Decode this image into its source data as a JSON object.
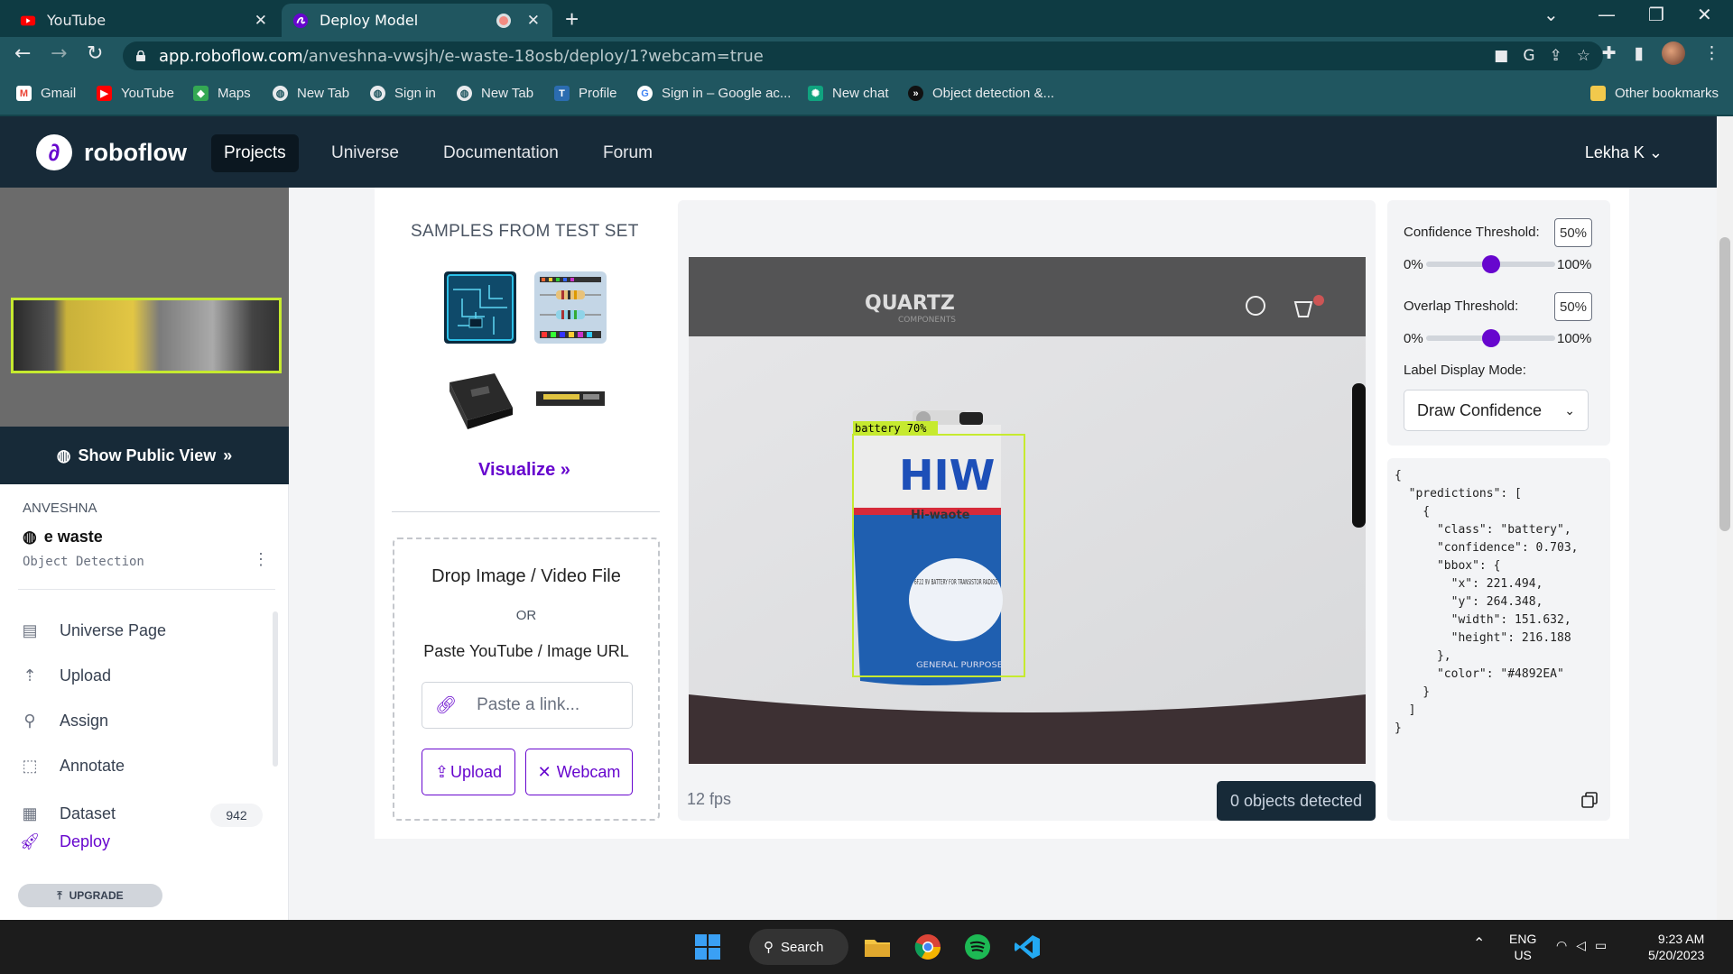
{
  "browser": {
    "tabs": [
      {
        "title": "YouTube"
      },
      {
        "title": "Deploy Model"
      }
    ],
    "url_domain": "app.roboflow.com",
    "url_path": "/anveshna-vwsjh/e-waste-18osb/deploy/1?webcam=true",
    "bookmarks": [
      "Gmail",
      "YouTube",
      "Maps",
      "New Tab",
      "Sign in",
      "New Tab",
      "Profile",
      "Sign in – Google ac...",
      "New chat",
      "Object detection &..."
    ],
    "other_bookmarks": "Other bookmarks"
  },
  "nav": {
    "brand": "roboflow",
    "links": [
      "Projects",
      "Universe",
      "Documentation",
      "Forum"
    ],
    "user": "Lekha K"
  },
  "sidebar": {
    "public_view": "Show Public View",
    "workspace": "ANVESHNA",
    "project": "e waste",
    "project_type": "Object Detection",
    "items": [
      {
        "label": "Universe Page",
        "icon": "document-icon"
      },
      {
        "label": "Upload",
        "icon": "upload-icon"
      },
      {
        "label": "Assign",
        "icon": "search-icon"
      },
      {
        "label": "Annotate",
        "icon": "annotate-icon"
      },
      {
        "label": "Dataset",
        "icon": "images-icon"
      },
      {
        "label": "Deploy",
        "icon": "rocket-icon"
      }
    ],
    "dataset_count": "942",
    "upgrade": "UPGRADE"
  },
  "samples": {
    "title": "SAMPLES FROM TEST SET",
    "visualize": "Visualize",
    "drop_title": "Drop Image / Video File",
    "or": "OR",
    "paste_label": "Paste YouTube / Image URL",
    "paste_placeholder": "Paste a link...",
    "upload_btn": "Upload",
    "webcam_btn": "Webcam"
  },
  "video": {
    "detection_label": "battery 70%",
    "fps": "12 fps",
    "objects_detected": "0 objects detected",
    "scene_text": {
      "brand": "QUARTZ",
      "sub": "COMPONENTS",
      "battery_brand": "HIW",
      "battery_sub": "Hi-waote",
      "battery_spec": "6F22 9V BATTERY FOR TRANSISTOR RADIOS",
      "battery_footer": "GENERAL PURPOSE"
    }
  },
  "settings": {
    "confidence_label": "Confidence Threshold:",
    "confidence_value": "50%",
    "overlap_label": "Overlap Threshold:",
    "overlap_value": "50%",
    "min": "0%",
    "max": "100%",
    "confidence_level": 0.5,
    "overlap_level": 0.5,
    "label_mode_label": "Label Display Mode:",
    "label_mode_value": "Draw Confidence"
  },
  "predictions_json": "{\n  \"predictions\": [\n    {\n      \"class\": \"battery\",\n      \"confidence\": 0.703,\n      \"bbox\": {\n        \"x\": 221.494,\n        \"y\": 264.348,\n        \"width\": 151.632,\n        \"height\": 216.188\n      },\n      \"color\": \"#4892EA\"\n    }\n  ]\n}",
  "taskbar": {
    "search": "Search",
    "lang_top": "ENG",
    "lang_bottom": "US",
    "time": "9:23 AM",
    "date": "5/20/2023"
  },
  "colors": {
    "accent": "#6706ce",
    "detection_box": "#c6ea2f",
    "nav_bg": "#172a38"
  }
}
